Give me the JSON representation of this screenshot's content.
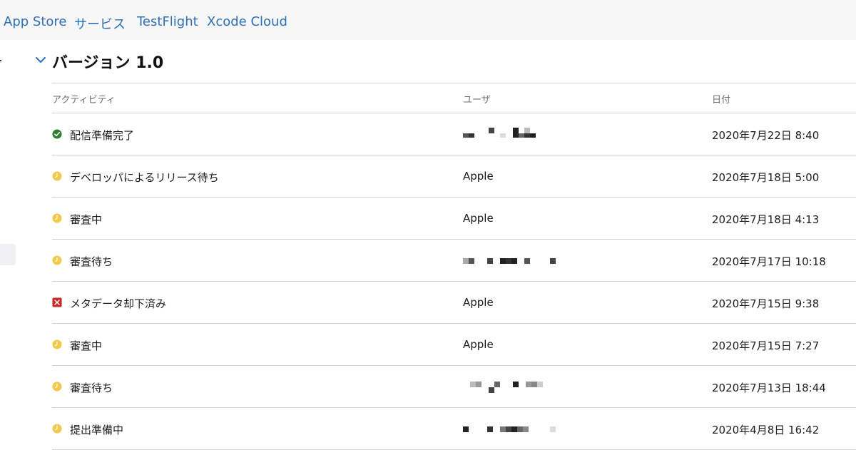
{
  "nav": {
    "tabs": [
      {
        "label": "App Store"
      },
      {
        "label": "サービス"
      },
      {
        "label": "TestFlight"
      },
      {
        "label": "Xcode Cloud"
      }
    ]
  },
  "section": {
    "title": "バージョン 1.0"
  },
  "table": {
    "headers": {
      "activity": "アクティビティ",
      "user": "ユーザ",
      "date": "日付"
    },
    "rows": [
      {
        "status": "ready",
        "activity": "配信準備完了",
        "user": "",
        "date": "2020年7月22日 8:40"
      },
      {
        "status": "waiting",
        "activity": "デベロッパによるリリース待ち",
        "user": "Apple",
        "date": "2020年7月18日 5:00"
      },
      {
        "status": "waiting",
        "activity": "審査中",
        "user": "Apple",
        "date": "2020年7月18日 4:13"
      },
      {
        "status": "waiting",
        "activity": "審査待ち",
        "user": "",
        "date": "2020年7月17日 10:18"
      },
      {
        "status": "rejected",
        "activity": "メタデータ却下済み",
        "user": "Apple",
        "date": "2020年7月15日 9:38"
      },
      {
        "status": "waiting",
        "activity": "審査中",
        "user": "Apple",
        "date": "2020年7月15日 7:27"
      },
      {
        "status": "waiting",
        "activity": "審査待ち",
        "user": "",
        "date": "2020年7月13日 18:44"
      },
      {
        "status": "waiting",
        "activity": "提出準備中",
        "user": "",
        "date": "2020年4月8日 16:42"
      }
    ]
  },
  "colors": {
    "accent": "#2f6fb7",
    "ready": "#2e7d32",
    "waiting": "#f2c94c",
    "rejected": "#c62828"
  },
  "icons": {
    "ready": "check-circle-icon",
    "waiting": "clock-icon",
    "rejected": "x-square-icon"
  }
}
